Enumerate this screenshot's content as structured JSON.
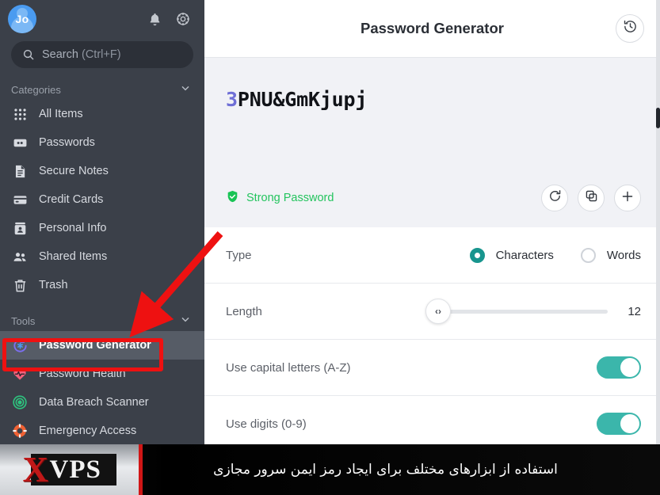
{
  "sidebar": {
    "avatar_initials": "Jo",
    "top_icons": [
      {
        "name": "bell-icon",
        "label": "Notifications"
      },
      {
        "name": "gear-icon",
        "label": "Settings"
      }
    ],
    "search": {
      "placeholder_text": "Search",
      "placeholder_hint": "(Ctrl+F)"
    },
    "sections": [
      {
        "id": "categories",
        "title": "Categories",
        "items": [
          {
            "label": "All Items",
            "icon": "grid-icon"
          },
          {
            "label": "Passwords",
            "icon": "password-card-icon"
          },
          {
            "label": "Secure Notes",
            "icon": "note-icon"
          },
          {
            "label": "Credit Cards",
            "icon": "credit-card-icon"
          },
          {
            "label": "Personal Info",
            "icon": "id-card-icon"
          },
          {
            "label": "Shared Items",
            "icon": "people-icon"
          },
          {
            "label": "Trash",
            "icon": "trash-icon"
          }
        ]
      },
      {
        "id": "tools",
        "title": "Tools",
        "items": [
          {
            "label": "Password Generator",
            "icon": "generator-icon",
            "active": true
          },
          {
            "label": "Password Health",
            "icon": "heart-pulse-icon"
          },
          {
            "label": "Data Breach Scanner",
            "icon": "radar-icon"
          },
          {
            "label": "Emergency Access",
            "icon": "life-ring-icon"
          }
        ]
      }
    ]
  },
  "main": {
    "title": "Password Generator",
    "history_button": "history-icon",
    "password": {
      "first_char": "3",
      "rest": "PNU&GmKjupj",
      "full": "3PNU&GmKjupj",
      "first_char_color": "#6f6fd6"
    },
    "strength": {
      "label": "Strong Password",
      "color": "#24c45e",
      "icon": "shield-check-icon"
    },
    "actions": [
      {
        "name": "regenerate-button",
        "icon": "refresh-icon"
      },
      {
        "name": "copy-button",
        "icon": "copy-icon"
      },
      {
        "name": "add-button",
        "icon": "plus-icon"
      }
    ],
    "options": {
      "type": {
        "label": "Type",
        "choices": [
          {
            "label": "Characters",
            "selected": true
          },
          {
            "label": "Words",
            "selected": false
          }
        ]
      },
      "length": {
        "label": "Length",
        "value": "12",
        "thumb_glyph": "‹›"
      },
      "toggles": [
        {
          "label": "Use capital letters (A-Z)",
          "on": true
        },
        {
          "label": "Use digits (0-9)",
          "on": true
        }
      ]
    }
  },
  "banner": {
    "logo_x": "X",
    "logo_vps": "VPS",
    "caption": "استفاده از ابزارهای مختلف برای ایجاد رمز ایمن سرور مجازی"
  },
  "annotations": {
    "arrow_color": "#ee1111",
    "highlight_color": "#ee1111"
  }
}
